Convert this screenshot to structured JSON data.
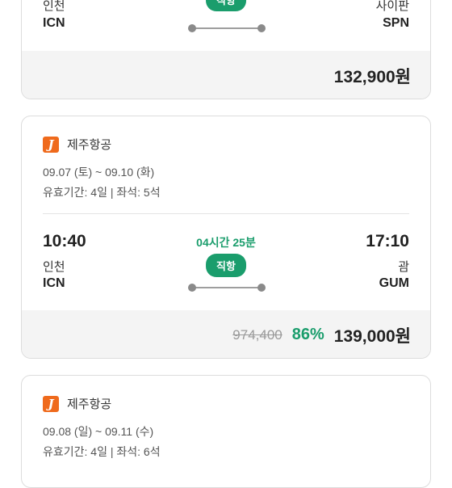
{
  "cards": [
    {
      "dep_city": "인천",
      "dep_code": "ICN",
      "arr_city": "사이판",
      "arr_code": "SPN",
      "badge": "직항",
      "price": "132,900원"
    },
    {
      "airline": "제주항공",
      "dates": "09.07 (토) ~ 09.10 (화)",
      "meta": "유효기간: 4일 | 좌석: 5석",
      "dep_time": "10:40",
      "dep_city": "인천",
      "dep_code": "ICN",
      "duration": "04시간 25분",
      "badge": "직항",
      "arr_time": "17:10",
      "arr_city": "괌",
      "arr_code": "GUM",
      "original_price": "974,400",
      "discount": "86%",
      "price": "139,000원"
    },
    {
      "airline": "제주항공",
      "dates": "09.08 (일) ~ 09.11 (수)",
      "meta": "유효기간: 4일 | 좌석: 6석"
    }
  ],
  "colors": {
    "accent": "#1a9d6c",
    "airline_logo": "#ef6a1c",
    "price_bar": "#f4f4f4"
  },
  "icons": {
    "airline_logo": "jeju-air-logo-icon"
  }
}
